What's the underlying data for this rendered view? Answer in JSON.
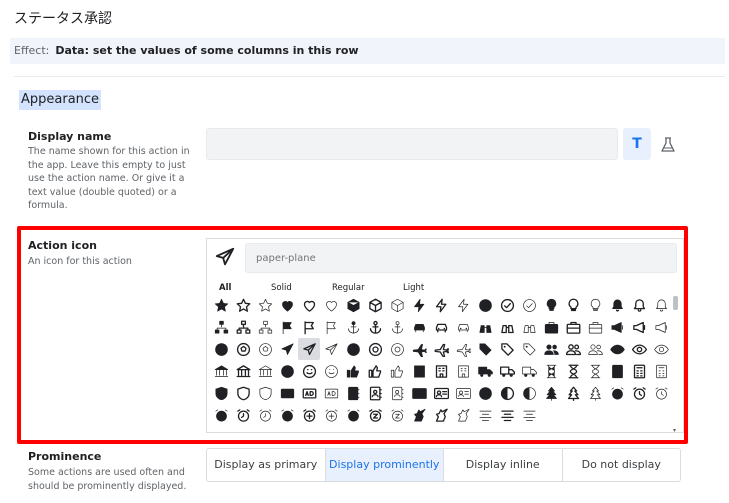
{
  "page": {
    "title": "ステータス承認"
  },
  "effect": {
    "label": "Effect:",
    "value": "Data: set the values of some columns in this row"
  },
  "section": {
    "title": "Appearance"
  },
  "display_name": {
    "label": "Display name",
    "desc_lines": [
      "The name shown for this action in",
      "the app. Leave this empty to just",
      "use the action name. Or give it a",
      "text value (double quoted) or a",
      "formula."
    ],
    "value": "",
    "text_button_icon": "T"
  },
  "action_icon": {
    "label": "Action icon",
    "desc": "An icon for this action",
    "placeholder": "paper-plane",
    "tabs": [
      "All",
      "Solid",
      "Regular",
      "Light"
    ],
    "selected_tab": "All",
    "selected_icon": "paper-plane-regular",
    "highlight_color": "#ff0000",
    "icons": [
      [
        "star",
        "star-regular",
        "star-light",
        "heart",
        "heart-regular",
        "heart-light",
        "cube",
        "cube-regular",
        "cube-light",
        "bolt",
        "bolt-regular",
        "bolt-light",
        "check-circle",
        "check-circle-regular",
        "check-circle-light",
        "lightbulb",
        "lightbulb-regular",
        "lightbulb-light",
        "bell",
        "bell-regular"
      ],
      [
        "bell-light",
        "sitemap",
        "sitemap-regular",
        "sitemap-light",
        "flag",
        "flag-regular",
        "flag-light",
        "anchor",
        "anchor-regular",
        "anchor-light",
        "car",
        "car-regular",
        "car-light",
        "binoculars",
        "binoculars-regular",
        "binoculars-light",
        "briefcase",
        "briefcase-regular",
        "briefcase-light",
        "bullhorn"
      ],
      [
        "bullhorn-regular",
        "bullhorn-light",
        "futbol",
        "futbol-regular",
        "futbol-light",
        "paper-plane",
        "paper-plane-regular",
        "paper-plane-light",
        "life-ring",
        "life-ring-regular",
        "life-ring-light",
        "plane",
        "plane-regular",
        "plane-light",
        "tag",
        "tag-regular",
        "tag-light",
        "users",
        "users-regular",
        "users-light"
      ],
      [
        "eye",
        "eye-regular",
        "eye-light",
        "university",
        "university-regular",
        "university-light",
        "smile",
        "smile-regular",
        "smile-light",
        "thumbs-up",
        "thumbs-up-regular",
        "thumbs-up-light",
        "building",
        "building-regular",
        "building-light",
        "truck",
        "truck-regular",
        "truck-light",
        "hourglass",
        "hourglass-regular"
      ],
      [
        "hourglass-light",
        "calculator",
        "calculator-regular",
        "calculator-light",
        "shield",
        "shield-regular",
        "shield-light",
        "ad",
        "ad-regular",
        "ad-light",
        "address-book",
        "address-book-regular",
        "address-book-light",
        "address-card",
        "address-card-regular",
        "address-card-light",
        "adjust",
        "adjust-regular",
        "adjust-light",
        "tree"
      ],
      [
        "tree-regular",
        "tree-light",
        "alarm-clock",
        "alarm-clock-regular",
        "alarm-clock-light",
        "alarm-clock-alt",
        "alarm-clock-alt-regular",
        "alarm-clock-alt-light",
        "alarm-plus",
        "alarm-plus-regular",
        "alarm-plus-light",
        "alarm-snooze",
        "alarm-snooze-regular",
        "alarm-snooze-light",
        "alicorn",
        "alicorn-regular",
        "alicorn-light",
        "align-center",
        "align-center-regular",
        "align-center-light"
      ]
    ]
  },
  "prominence": {
    "label": "Prominence",
    "desc_lines": [
      "Some actions are used often and",
      "should be prominently displayed."
    ],
    "options": [
      "Display as primary",
      "Display prominently",
      "Display inline",
      "Do not display"
    ],
    "selected": "Display prominently"
  },
  "colors": {
    "accent": "#1a73e8",
    "selected_bg": "#e8f0fe",
    "effect_bg": "#f1f4fb",
    "section_highlight": "#d3e3fd"
  }
}
